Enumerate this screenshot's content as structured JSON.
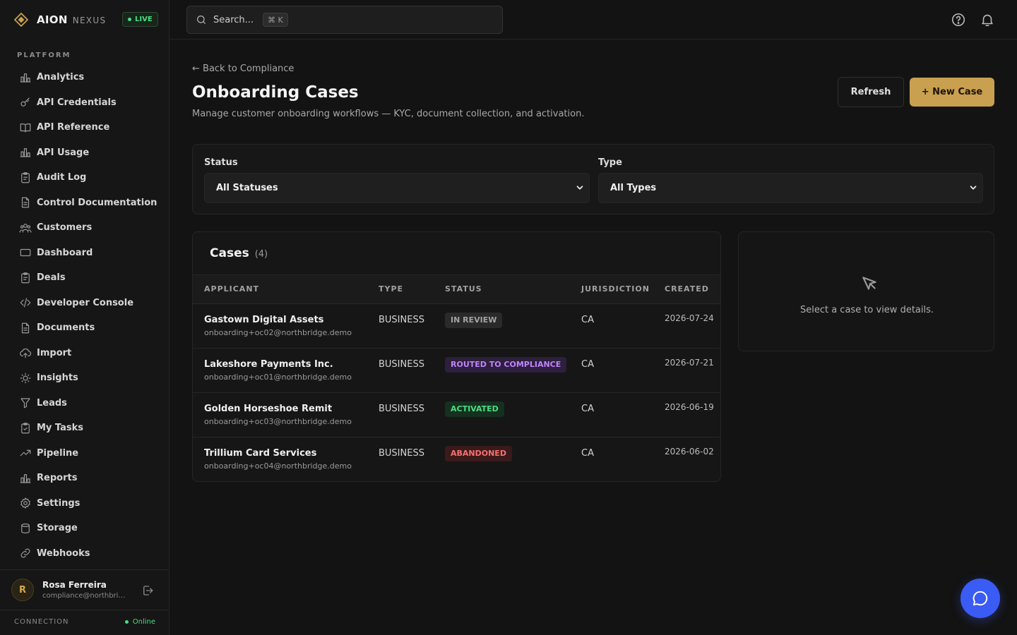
{
  "brand": {
    "name": "AION",
    "sub": "NEXUS",
    "live_label": "LIVE",
    "accent": "#c9a04f"
  },
  "sidebar": {
    "section_label": "PLATFORM",
    "items": [
      {
        "label": "Analytics",
        "icon": "bar-chart-icon"
      },
      {
        "label": "API Credentials",
        "icon": "key-icon"
      },
      {
        "label": "API Reference",
        "icon": "book-icon"
      },
      {
        "label": "API Usage",
        "icon": "bar-chart-icon"
      },
      {
        "label": "Audit Log",
        "icon": "clipboard-icon"
      },
      {
        "label": "Control Documentation",
        "icon": "document-icon"
      },
      {
        "label": "Customers",
        "icon": "users-icon"
      },
      {
        "label": "Dashboard",
        "icon": "monitor-icon"
      },
      {
        "label": "Deals",
        "icon": "clipboard-icon"
      },
      {
        "label": "Developer Console",
        "icon": "code-icon"
      },
      {
        "label": "Documents",
        "icon": "document-icon"
      },
      {
        "label": "Import",
        "icon": "cloud-upload-icon"
      },
      {
        "label": "Insights",
        "icon": "lightbulb-icon"
      },
      {
        "label": "Leads",
        "icon": "funnel-icon"
      },
      {
        "label": "My Tasks",
        "icon": "clipboard-check-icon"
      },
      {
        "label": "Pipeline",
        "icon": "trend-icon"
      },
      {
        "label": "Reports",
        "icon": "bar-chart-icon"
      },
      {
        "label": "Settings",
        "icon": "gear-icon"
      },
      {
        "label": "Storage",
        "icon": "database-icon"
      },
      {
        "label": "Webhooks",
        "icon": "link-icon"
      }
    ]
  },
  "user": {
    "initial": "R",
    "name": "Rosa Ferreira",
    "email": "compliance@northbridg..."
  },
  "connection": {
    "label": "CONNECTION",
    "status": "Online"
  },
  "topbar": {
    "search_placeholder": "Search...",
    "shortcut": "⌘ K"
  },
  "page": {
    "back_label": "← Back to Compliance",
    "title": "Onboarding Cases",
    "subtitle": "Manage customer onboarding workflows — KYC, document collection, and activation.",
    "refresh_label": "Refresh",
    "new_label": "+ New Case"
  },
  "filters": {
    "status_label": "Status",
    "status_value": "All Statuses",
    "type_label": "Type",
    "type_value": "All Types"
  },
  "cases": {
    "title": "Cases",
    "count": "(4)",
    "columns": [
      "APPLICANT",
      "TYPE",
      "STATUS",
      "JURISDICTION",
      "CREATED"
    ],
    "rows": [
      {
        "name": "Gastown Digital Assets",
        "email": "onboarding+oc02@northbridge.demo",
        "type": "BUSINESS",
        "status": "IN REVIEW",
        "jurisdiction": "CA",
        "created": "2026-07-24"
      },
      {
        "name": "Lakeshore Payments Inc.",
        "email": "onboarding+oc01@northbridge.demo",
        "type": "BUSINESS",
        "status": "ROUTED TO COMPLIANCE",
        "jurisdiction": "CA",
        "created": "2026-07-21"
      },
      {
        "name": "Golden Horseshoe Remit",
        "email": "onboarding+oc03@northbridge.demo",
        "type": "BUSINESS",
        "status": "ACTIVATED",
        "jurisdiction": "CA",
        "created": "2026-06-19"
      },
      {
        "name": "Trillium Card Services",
        "email": "onboarding+oc04@northbridge.demo",
        "type": "BUSINESS",
        "status": "ABANDONED",
        "jurisdiction": "CA",
        "created": "2026-06-02"
      }
    ]
  },
  "status_colors": {
    "IN REVIEW": {
      "fg": "#a3a3a3",
      "bg": "#2a2a2a"
    },
    "ROUTED TO COMPLIANCE": {
      "fg": "#c084fc",
      "bg": "#2d1f3d"
    },
    "ACTIVATED": {
      "fg": "#4ade80",
      "bg": "#15301f"
    },
    "ABANDONED": {
      "fg": "#f87171",
      "bg": "#3a1a1a"
    }
  },
  "detail": {
    "empty_text": "Select a case to view details."
  }
}
